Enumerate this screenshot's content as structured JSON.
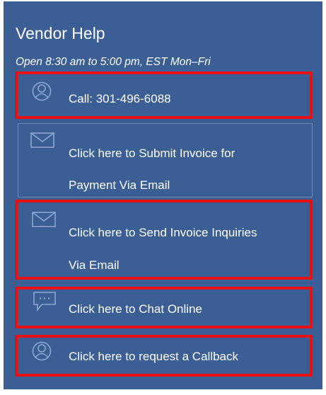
{
  "panel": {
    "title": "Vendor Help",
    "hours": "Open 8:30 am to 5:00 pm, EST Mon–Fri"
  },
  "items": [
    {
      "icon": "person-icon",
      "lines": [
        "Call: 301-496-6088"
      ]
    },
    {
      "icon": "envelope-icon",
      "lines": [
        "Click here to Submit Invoice for",
        "Payment Via Email"
      ]
    },
    {
      "icon": "envelope-icon",
      "lines": [
        "Click here to Send Invoice Inquiries",
        "Via Email"
      ]
    },
    {
      "icon": "chat-bubble-icon",
      "lines": [
        "Click here to Chat Online"
      ]
    },
    {
      "icon": "person-icon",
      "lines": [
        "Click here to request a Callback"
      ]
    }
  ],
  "colors": {
    "panel_bg": "#3b5f95",
    "highlight": "#e81010",
    "text": "#ffffff"
  }
}
